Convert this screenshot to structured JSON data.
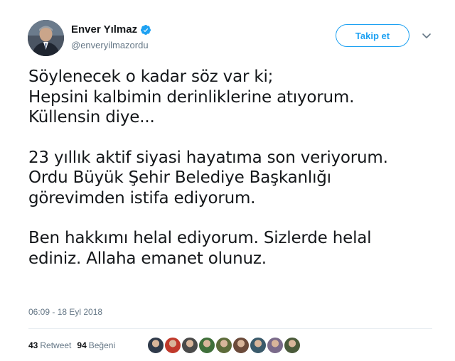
{
  "author": {
    "name": "Enver Yılmaz",
    "handle": "@enveryilmazordu",
    "verified": true
  },
  "follow_button": {
    "label": "Takip et"
  },
  "tweet": {
    "paragraphs": [
      "Söylenecek o kadar söz var ki;\nHepsini kalbimin derinliklerine atıyorum.\nKüllensin diye...",
      "23 yıllık aktif siyasi hayatıma son veriyorum.\nOrdu Büyük Şehir Belediye Başkanlığı\ngörevimden istifa ediyorum.",
      "Ben hakkımı helal ediyorum. Sizlerde helal\nediniz. Allaha emanet olunuz."
    ],
    "timestamp": "06:09 - 18 Eyl 2018"
  },
  "stats": {
    "retweets": "43",
    "retweet_label": "Retweet",
    "likes": "94",
    "like_label": "Beğeni"
  },
  "colors": {
    "accent": "#1da1f2",
    "text": "#14171a",
    "muted": "#657786"
  },
  "liker_colors": [
    "#2f3a4a",
    "#c0392b",
    "#4a4a4a",
    "#3f6f3a",
    "#5d6b3a",
    "#6b4a3a",
    "#3a5a6b",
    "#7a6a8a",
    "#4a5a3a"
  ]
}
